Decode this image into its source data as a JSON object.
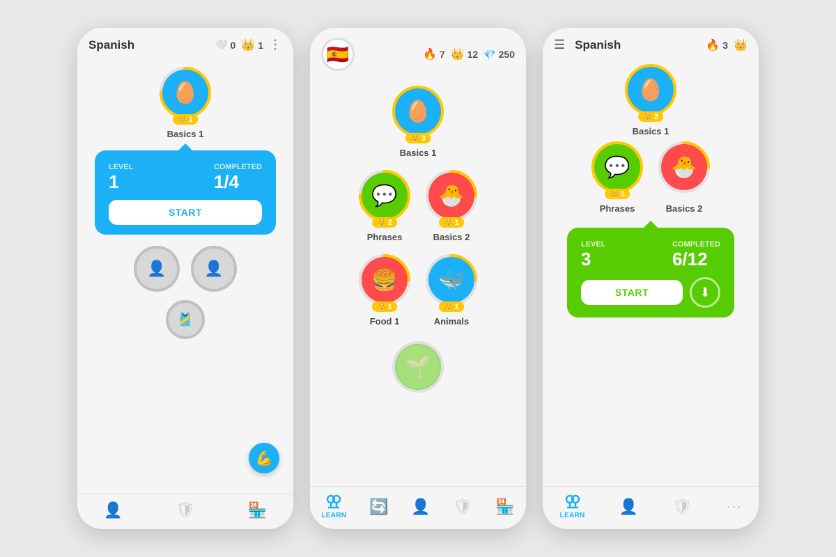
{
  "app": {
    "background": "#e8e8e8"
  },
  "phone1": {
    "title": "Spanish",
    "stats": {
      "hearts": "0",
      "crowns": "1"
    },
    "basics1": {
      "label": "Basics 1",
      "crown_level": "1"
    },
    "popup": {
      "level_label": "Level",
      "level_value": "1",
      "completed_label": "Completed",
      "completed_value": "1/4",
      "start_label": "START"
    },
    "ghost_nodes": [
      "👤",
      "👤"
    ],
    "nav": [
      {
        "icon": "👤",
        "label": ""
      },
      {
        "icon": "🛡",
        "label": ""
      },
      {
        "icon": "🏪",
        "label": ""
      }
    ]
  },
  "phone2": {
    "flag": "🇪🇸",
    "stats": {
      "flames": "7",
      "crowns": "12",
      "gems": "250"
    },
    "basics1": {
      "label": "Basics 1",
      "crown_level": "3"
    },
    "phrases": {
      "label": "Phrases",
      "crown_level": "2"
    },
    "basics2": {
      "label": "Basics 2",
      "crown_level": "1"
    },
    "food1": {
      "label": "Food 1",
      "crown_level": "1"
    },
    "animals": {
      "label": "Animals",
      "crown_level": "1"
    },
    "nav": [
      {
        "icon": "LEARN",
        "label": "LEARN",
        "active": true
      },
      {
        "icon": "🔄",
        "label": ""
      },
      {
        "icon": "👤",
        "label": ""
      },
      {
        "icon": "🛡",
        "label": ""
      },
      {
        "icon": "🏪",
        "label": ""
      }
    ]
  },
  "phone3": {
    "menu_icon": "☰",
    "title": "Spanish",
    "stats": {
      "flames": "3"
    },
    "basics1": {
      "label": "Basics 1",
      "crown_level": "2"
    },
    "phrases": {
      "label": "Phrases",
      "crown_level": "3"
    },
    "basics2": {
      "label": "Basics 2",
      "crown_level": ""
    },
    "popup": {
      "level_label": "Level",
      "level_value": "3",
      "completed_label": "Completed",
      "completed_value": "6/12",
      "start_label": "START"
    },
    "nav": [
      {
        "icon": "Learn",
        "label": "Learn",
        "active": true
      },
      {
        "icon": "👤",
        "label": ""
      },
      {
        "icon": "🛡",
        "label": ""
      },
      {
        "icon": "",
        "label": ""
      }
    ]
  }
}
